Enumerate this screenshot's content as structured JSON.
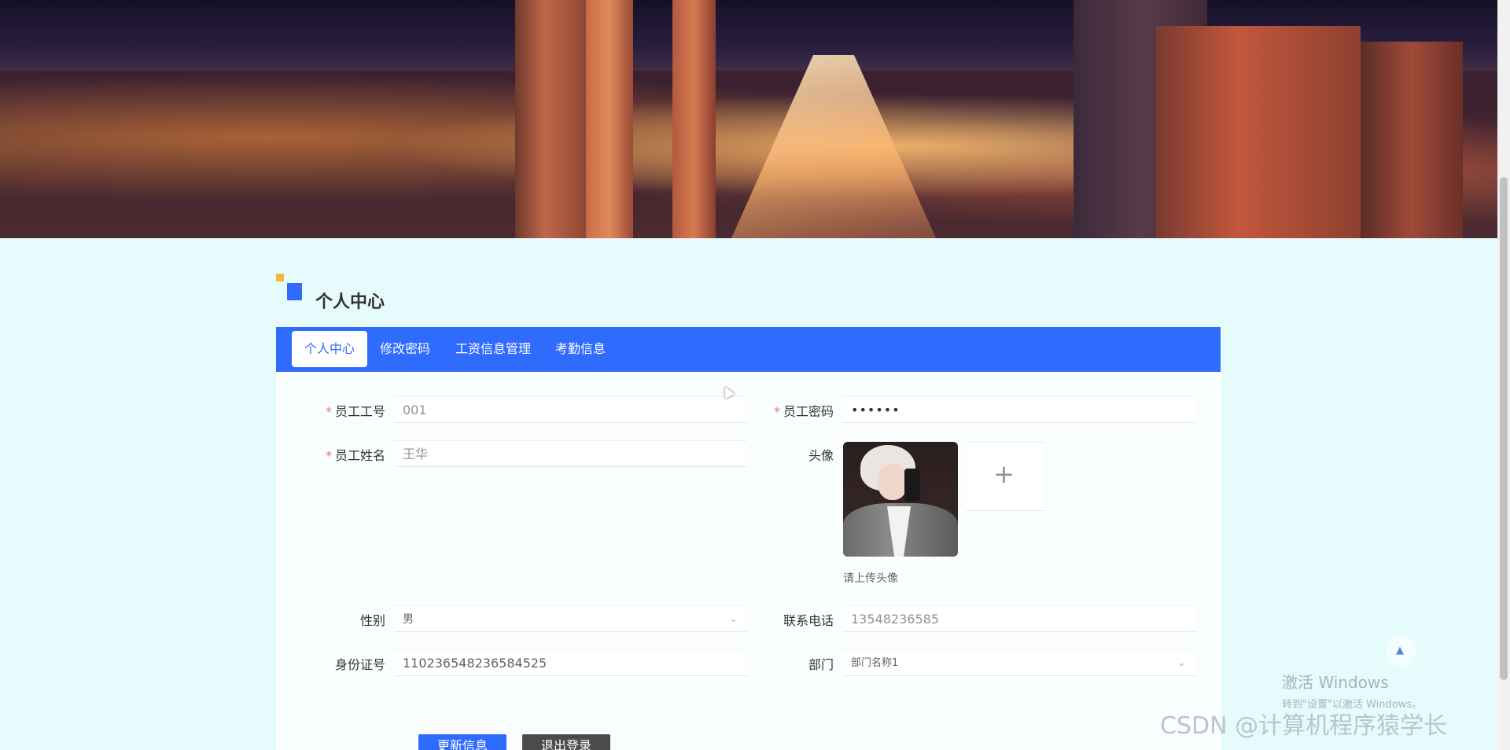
{
  "page": {
    "section_title": "个人中心"
  },
  "tabs": [
    {
      "label": "个人中心",
      "active": true
    },
    {
      "label": "修改密码",
      "active": false
    },
    {
      "label": "工资信息管理",
      "active": false
    },
    {
      "label": "考勤信息",
      "active": false
    }
  ],
  "form": {
    "employee_id": {
      "label": "员工工号",
      "required": true,
      "value": "001"
    },
    "employee_password": {
      "label": "员工密码",
      "required": true,
      "value": "••••••"
    },
    "employee_name": {
      "label": "员工姓名",
      "required": true,
      "value": "王华"
    },
    "avatar": {
      "label": "头像",
      "hint": "请上传头像"
    },
    "gender": {
      "label": "性别",
      "value": "男"
    },
    "phone": {
      "label": "联系电话",
      "value": "13548236585"
    },
    "id_number": {
      "label": "身份证号",
      "value": "110236548236584525"
    },
    "department": {
      "label": "部门",
      "value": "部门名称1"
    }
  },
  "buttons": {
    "update": "更新信息",
    "logout": "退出登录"
  },
  "overlay": {
    "activate_title": "激活 Windows",
    "activate_sub": "转到\"设置\"以激活 Windows。",
    "watermark": "CSDN @计算机程序猿学长"
  },
  "colors": {
    "primary": "#2f6bfd",
    "accent": "#f5b942",
    "background": "#e6fbfc",
    "required": "#f56c6c"
  }
}
